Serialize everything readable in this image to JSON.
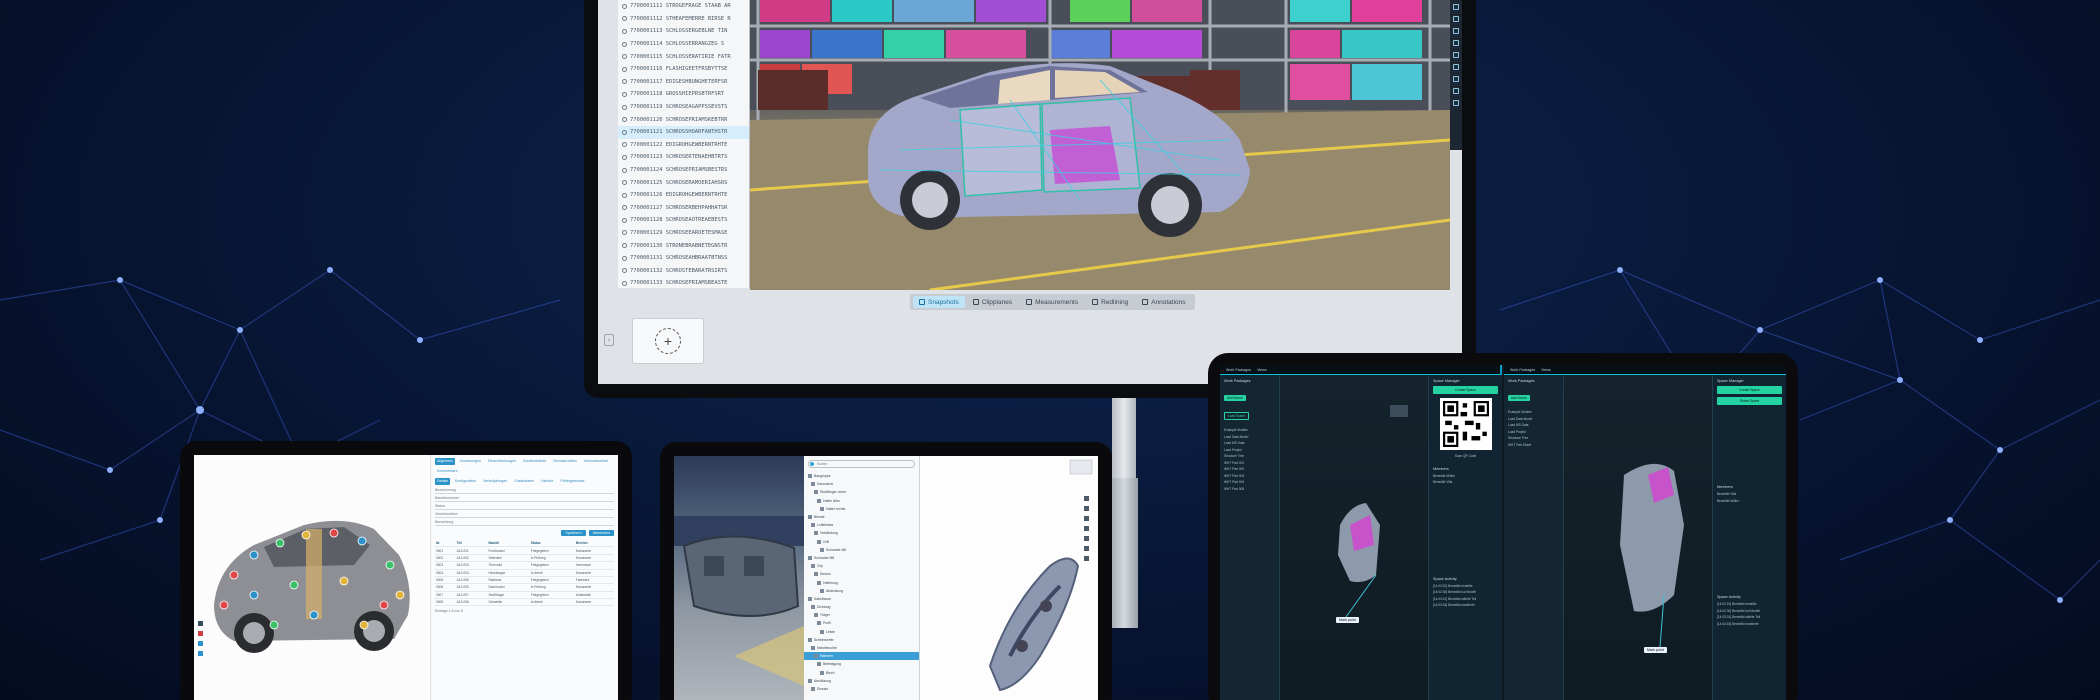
{
  "monitor": {
    "tree_rows": [
      "7700001111 STROGEFRAGE STAAB AR",
      "7700001112 STHEAFEMERRE BIRSE R",
      "7700001113 SCHLOSSERGEBLNE TIN",
      "7700001114 SCHLOSSERRANGZEG S",
      "7700001115 SCHLOSSERATIRIE FATR",
      "7700001116 FLASHIGEETFRSBYTTSE",
      "7700001117 EDIGESHBUNGHETERFSR",
      "7700001118 GROSSHIEPRSBTRFSRT",
      "7700001119 SCHROSEAGAPPSSEVSTS",
      "7700001120 SCHROSEPRIAMSKEBTRR",
      "7700001121 SCHROSSHOARFANTHSTR",
      "7700001122 EDIGROHGEWBERNTRHTE",
      "7700001123 SCHROSERTENAEHBTRTS",
      "7700001124 SCHROSEPRIAMSBESTRS",
      "7700001125 SCHROSERAMOERIAHSRS",
      "7700001126 EDIGROHGEWBERNTRHTE",
      "7700001127 SCHROSERBEHPAHHATSR",
      "7700001128 SCHROSEAOTREAEBESTS",
      "7700001129 SCHROSEEAROETESMASE",
      "7700001130 STRONEBRABNETEGNSTR",
      "7700001131 SCHROSEAHBRAATBTNSS",
      "7700001132 SCHROSTEBARATRSIRTS",
      "7700001133 SCHROSEPRIAMSBEASTE"
    ],
    "toolbar": [
      {
        "label": "Snapshots",
        "active": true
      },
      {
        "label": "Clipplanes",
        "active": false
      },
      {
        "label": "Measurements",
        "active": false
      },
      {
        "label": "Redlining",
        "active": false
      },
      {
        "label": "Annotations",
        "active": false
      }
    ],
    "add_view_glyph": "+",
    "side_handle_glyph": "›"
  },
  "left_tablet": {
    "tabs": [
      "Allgemein",
      "Zuweisungen",
      "Einschränkungen",
      "Sonderabläufe",
      "Benutzerdaten",
      "Versionsverlauf",
      "Kommentare"
    ],
    "sub_tabs": [
      "Details",
      "Konfiguration",
      "Verknüpfungen",
      "Zusatzdaten",
      "Historie",
      "Prüfergebnisse"
    ],
    "fields": [
      "Bezeichnung",
      "Bauteilnummer",
      "Status",
      "Verantwortlich",
      "Bemerkung"
    ],
    "buttons": [
      "Speichern",
      "Abbrechen"
    ],
    "table_headers": [
      "Nr.",
      "Teil",
      "Bauteil",
      "Status",
      "Bereich"
    ],
    "table_rows": [
      [
        "0001",
        "A12-001",
        "Frontmodul",
        "Freigegeben",
        "Karosserie"
      ],
      [
        "0002",
        "A12-002",
        "Seitenteil",
        "In Prüfung",
        "Karosserie"
      ],
      [
        "0003",
        "A12-003",
        "Türmodul",
        "Freigegeben",
        "Innenraum"
      ],
      [
        "0004",
        "A12-004",
        "Heckklappe",
        "In Arbeit",
        "Karosserie"
      ],
      [
        "0005",
        "A12-005",
        "Radhaus",
        "Freigegeben",
        "Fahrwerk"
      ],
      [
        "0006",
        "A12-006",
        "Dachmodul",
        "In Prüfung",
        "Karosserie"
      ],
      [
        "0007",
        "A12-007",
        "Stoßfänger",
        "Freigegeben",
        "Anbauteile"
      ],
      [
        "0008",
        "A12-008",
        "Schweller",
        "In Arbeit",
        "Karosserie"
      ]
    ],
    "footer": "Einträge 1-8 von 8"
  },
  "mid_tablet": {
    "search_placeholder": "Suche",
    "tree_rows": [
      "Baugruppe",
      "Karosserie",
      "Stoßfänger vorne",
      "Halter links",
      "Halter rechts",
      "Blende",
      "Lufteinlass",
      "Verkleidung",
      "Grill",
      "Schraube M6",
      "Schraube M8",
      "Clip",
      "Sensor",
      "Halterung",
      "Abdeckung",
      "Kabelbaum",
      "Dichtung",
      "Träger",
      "Profil",
      "Leiste",
      "Scheinwerfer",
      "Nebelleuchte",
      "Rahmen",
      "Befestigung",
      "Blech",
      "Abstützung",
      "Einsatz"
    ],
    "selected_row": 22
  },
  "right_tablet": {
    "left": {
      "top_tabs": [
        "Work Packages",
        "Views"
      ],
      "side_title": "Work Packages",
      "chips": [
        "Add Scene",
        "Load Scene"
      ],
      "side_list": [
        "Example Models",
        "Load Data Model",
        "Load MS Data",
        "Load Project",
        "Structure Tree",
        "WHT Part 001",
        "WHT Part 002",
        "WHT Part 003",
        "WHT Part 004",
        "WHT Part 005"
      ],
      "panel_title": "Space Manager",
      "panel_button": "Create Space",
      "qr_caption": "Scan QR Code",
      "members_title": "Members",
      "members": [
        "Benedikt Müller",
        "Benedikt Villa"
      ],
      "activity_title": "Space Activity",
      "activity": [
        "[14:02:10] Benedikt erstellte",
        "[14:02:30] Benedikt lud Modell",
        "[14:03:01] Benedikt wählte Teil",
        "[14:03:18] Benedikt markierte"
      ],
      "callout": "Mark point"
    },
    "right": {
      "top_tabs": [
        "Work Packages",
        "Views"
      ],
      "side_title": "Work Packages",
      "chips": [
        "Add Scene"
      ],
      "side_list": [
        "Example Models",
        "Load Data Model",
        "Load MS Data",
        "Load Project",
        "Structure Tree",
        "WHT Part Sheet"
      ],
      "panel_title": "Space Manager",
      "panel_buttons": [
        "Create Space",
        "Share Space"
      ],
      "members_title": "Members",
      "members": [
        "Benedikt Villa",
        "Benedikt Müller"
      ],
      "activity_title": "Space Activity",
      "activity": [
        "[14:02:10] Benedikt erstellte",
        "[14:02:30] Benedikt lud Modell",
        "[14:03:01] Benedikt wählte Teil",
        "[14:03:18] Benedikt markierte"
      ],
      "callout": "Mark point"
    }
  }
}
